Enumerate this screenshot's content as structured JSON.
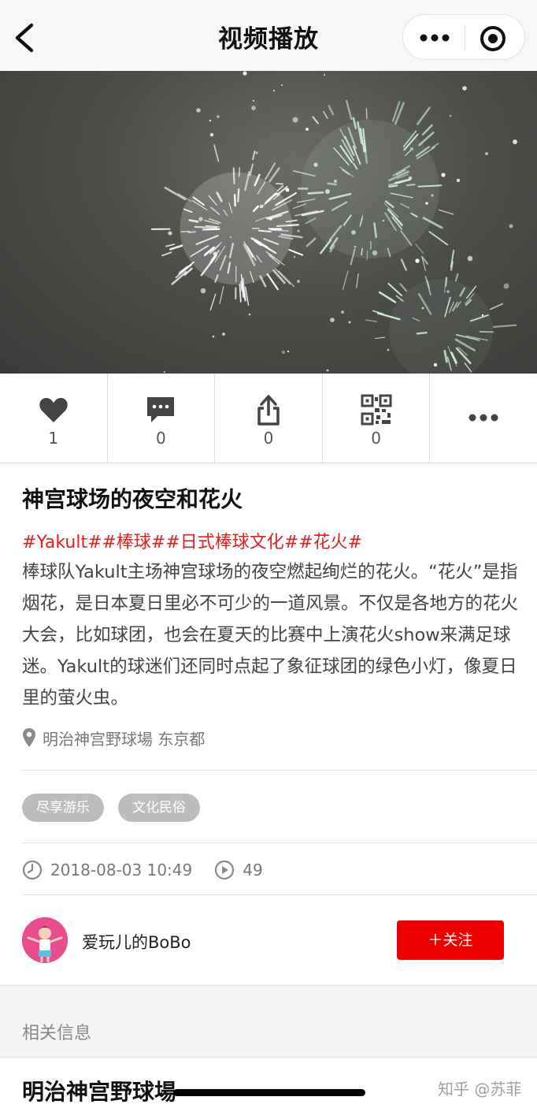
{
  "navbar": {
    "title": "视频播放",
    "back_icon": "chevron-left-icon",
    "more_icon": "more-dots-icon",
    "close_icon": "target-close-icon"
  },
  "video": {
    "poster": "fireworks-night-sky",
    "colors": {
      "sky": "#4d4d4a",
      "spark_white": "#ffffff",
      "spark_green": "#cdebd8"
    }
  },
  "actions": [
    {
      "icon": "heart-icon",
      "count": "1"
    },
    {
      "icon": "comment-icon",
      "count": "0"
    },
    {
      "icon": "share-icon",
      "count": "0"
    },
    {
      "icon": "qrcode-icon",
      "count": "0"
    },
    {
      "icon": "more-dots-icon",
      "count": ""
    }
  ],
  "post": {
    "title": "神宫球场的夜空和花火",
    "hashtags": "#Yakult##棒球##日式棒球文化##花火#",
    "description": "棒球队Yakult主场神宫球场的夜空燃起绚烂的花火。“花火”是指烟花，是日本夏日里必不可少的一道风景。不仅是各地方的花火大会，比如球团，也会在夏天的比赛中上演花火show来满足球迷。Yakult的球迷们还同时点起了象征球团的绿色小灯，像夏日里的萤火虫。",
    "location": "明治神宫野球場 东京都"
  },
  "tags": [
    "尽享游乐",
    "文化民俗"
  ],
  "meta": {
    "datetime": "2018-08-03 10:49",
    "views": "49"
  },
  "author": {
    "name": "爱玩儿的BoBo",
    "follow_label": "＋关注"
  },
  "related": {
    "label": "相关信息",
    "place_title": "明治神宫野球場"
  },
  "watermark": "知乎 @苏菲",
  "colors": {
    "accent_red": "#ee0000",
    "hashtag_red": "#e02020",
    "tag_gray": "#bdbdbd"
  }
}
